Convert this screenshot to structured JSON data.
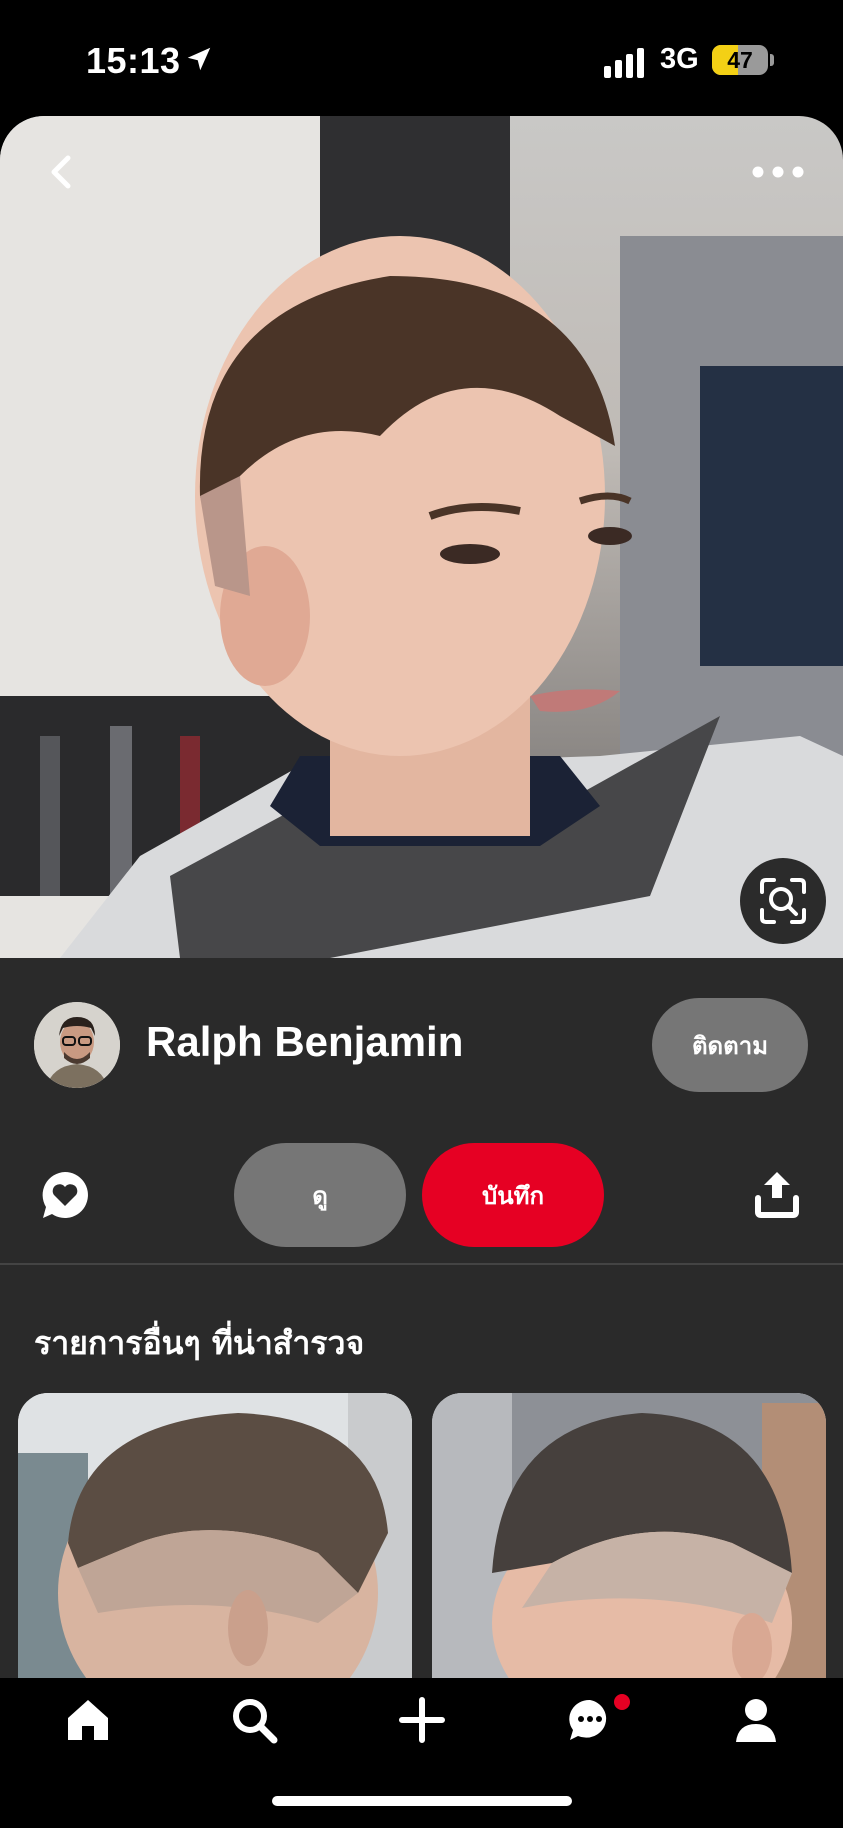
{
  "status_bar": {
    "time": "15:13",
    "network": "3G",
    "battery": "47",
    "battery_level": 0.47
  },
  "pin": {
    "author": "Ralph Benjamin",
    "follow_label": "ติดตาม",
    "view_label": "ดู",
    "save_label": "บันทึก",
    "more_ideas_title": "รายการอื่นๆ ที่น่าสำรวจ"
  },
  "icons": {
    "back": "chevron-left-icon",
    "more": "more-dots-icon",
    "visual_search": "visual-search-icon",
    "comment": "comment-heart-icon",
    "share": "share-icon",
    "nav": [
      "home-icon",
      "search-icon",
      "plus-icon",
      "messages-icon",
      "profile-icon"
    ]
  },
  "colors": {
    "accent": "#e60023",
    "panel": "#2a2a2a",
    "button_gray": "#767676"
  }
}
